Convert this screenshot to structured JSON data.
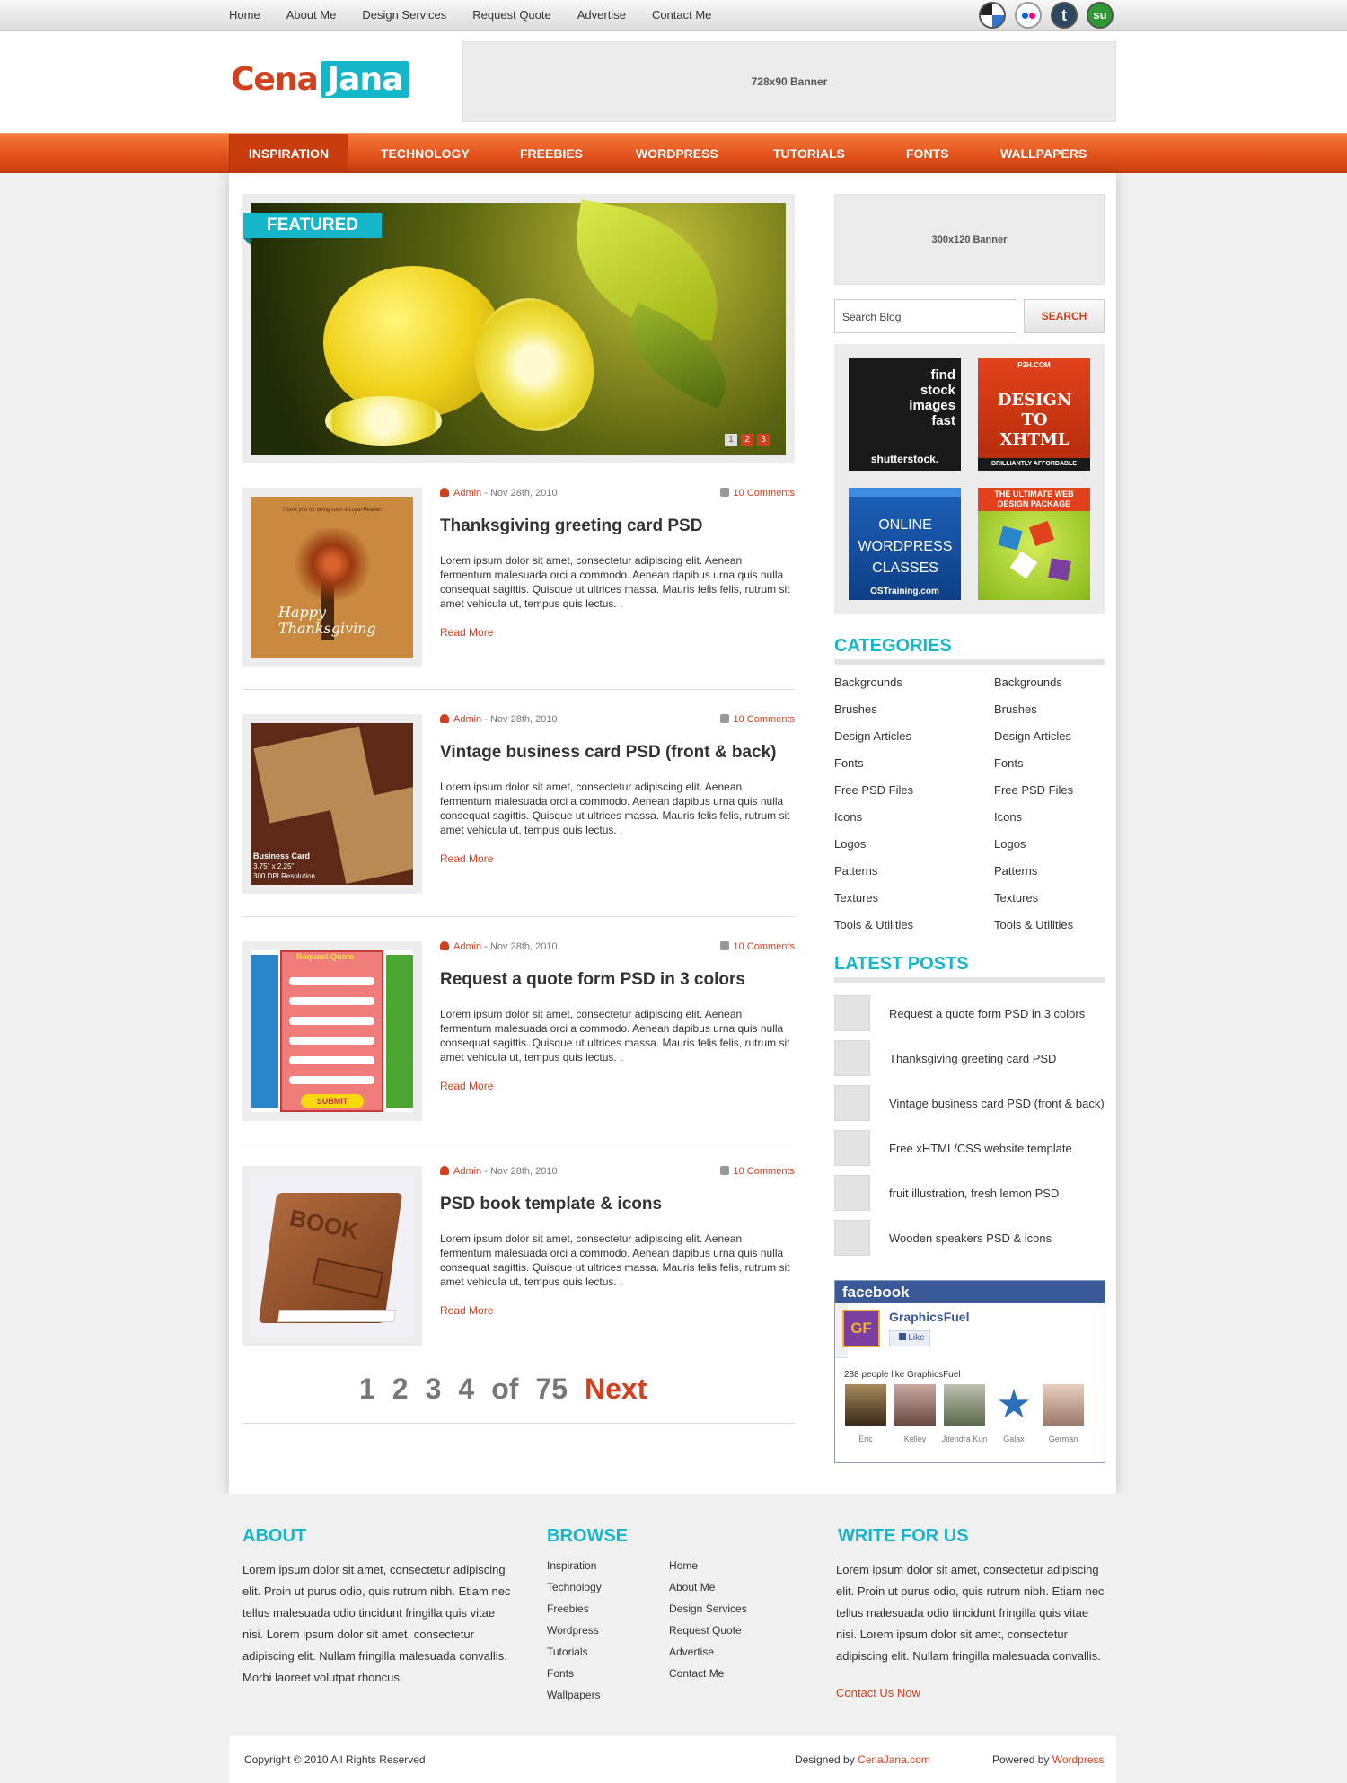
{
  "topnav": [
    "Home",
    "About Me",
    "Design Services",
    "Request Quote",
    "Advertise",
    "Contact Me"
  ],
  "social": [
    "delicious-icon",
    "flickr-icon",
    "tumblr-icon",
    "stumbleupon-icon"
  ],
  "logo": {
    "first": "Cena",
    "second": "Jana"
  },
  "banner_top": "728x90 Banner",
  "mainnav": [
    "INSPIRATION",
    "TECHNOLOGY",
    "FREEBIES",
    "WORDPRESS",
    "TUTORIALS",
    "FONTS",
    "WALLPAPERS"
  ],
  "featured": {
    "label": "FEATURED",
    "pages": [
      "1",
      "2",
      "3"
    ]
  },
  "posts": [
    {
      "author": "Admin",
      "date": "Nov 28th, 2010",
      "comments": "10 Comments",
      "title": "Thanksgiving greeting card PSD",
      "body": "Lorem ipsum dolor sit amet, consectetur adipiscing elit. Aenean fermentum malesuada orci a commodo. Aenean dapibus urna quis nulla consequat sagittis. Quisque ut ultrices massa. Mauris felis felis, rutrum sit amet vehicula ut, tempus quis lectus. .",
      "more": "Read More",
      "thumb": {
        "line1": "Thank you for being such a Loyal Reader!",
        "line2": "Happy Thanksgiving"
      }
    },
    {
      "author": "Admin",
      "date": "Nov 28th, 2010",
      "comments": "10 Comments",
      "title": "Vintage business card PSD (front & back)",
      "body": "Lorem ipsum dolor sit amet, consectetur adipiscing elit. Aenean fermentum malesuada orci a commodo. Aenean dapibus urna quis nulla consequat sagittis. Quisque ut ultrices massa. Mauris felis felis, rutrum sit amet vehicula ut, tempus quis lectus. .",
      "more": "Read More",
      "thumb": {
        "line1": "Business Card",
        "line2": "3.75\" x 2.25\"",
        "line3": "300 DPI Resolution"
      }
    },
    {
      "author": "Admin",
      "date": "Nov 28th, 2010",
      "comments": "10 Comments",
      "title": "Request a quote form PSD in 3 colors",
      "body": "Lorem ipsum dolor sit amet, consectetur adipiscing elit. Aenean fermentum malesuada orci a commodo. Aenean dapibus urna quis nulla consequat sagittis. Quisque ut ultrices massa. Mauris felis felis, rutrum sit amet vehicula ut, tempus quis lectus. .",
      "more": "Read More",
      "thumb": {
        "line1": "Request Quote",
        "line2": "SUBMIT"
      }
    },
    {
      "author": "Admin",
      "date": "Nov 28th, 2010",
      "comments": "10 Comments",
      "title": "PSD book template & icons",
      "body": "Lorem ipsum dolor sit amet, consectetur adipiscing elit. Aenean fermentum malesuada orci a commodo. Aenean dapibus urna quis nulla consequat sagittis. Quisque ut ultrices massa. Mauris felis felis, rutrum sit amet vehicula ut, tempus quis lectus. .",
      "more": "Read More",
      "thumb": {
        "line1": "BOOK"
      }
    }
  ],
  "pager": {
    "pages": [
      "1",
      "2",
      "3",
      "4"
    ],
    "of": "of",
    "total": "75",
    "next": "Next"
  },
  "sidebar": {
    "banner": "300x120 Banner",
    "search_placeholder": "Search Blog",
    "search_button": "SEARCH",
    "ads": [
      {
        "t1": "find stock images fast",
        "t2": "shutterstock."
      },
      {
        "t1": "P2H.COM",
        "t2": "DESIGN TO XHTML",
        "t3": "BRILLIANTLY AFFORDABLE"
      },
      {
        "t1": "ONLINE WORDPRESS CLASSES",
        "t2": "OSTraining.com"
      },
      {
        "t1": "THE ULTIMATE WEB DESIGN PACKAGE"
      }
    ],
    "categories_title": "CATEGORIES",
    "categories": [
      "Backgrounds",
      "Brushes",
      "Design Articles",
      "Fonts",
      "Free PSD Files",
      "Icons",
      "Logos",
      "Patterns",
      "Textures",
      "Tools & Utilities"
    ],
    "latest_title": "LATEST POSTS",
    "latest": [
      "Request a quote form PSD in 3 colors",
      "Thanksgiving greeting card PSD",
      "Vintage business card PSD (front & back)",
      "Free xHTML/CSS website template",
      "fruit illustration, fresh lemon PSD",
      "Wooden speakers PSD & icons"
    ],
    "facebook": {
      "title": "facebook",
      "page": "GraphicsFuel",
      "like": "Like",
      "count": "288 people like GraphicsFuel",
      "fans": [
        "Eric",
        "Kelley",
        "Jitendra Kun",
        "Galax",
        "German"
      ],
      "logo": "GF"
    }
  },
  "footer": {
    "about_title": "ABOUT",
    "about_text": "Lorem ipsum dolor sit amet, consectetur adipiscing elit. Proin ut purus odio, quis rutrum nibh. Etiam nec tellus malesuada odio tincidunt fringilla quis vitae nisi. Lorem ipsum dolor sit amet, consectetur adipiscing elit. Nullam fringilla malesuada convallis. Morbi laoreet volutpat rhoncus.",
    "browse_title": "BROWSE",
    "browse_col1": [
      "Inspiration",
      "Technology",
      "Freebies",
      "Wordpress",
      "Tutorials",
      "Fonts",
      "Wallpapers"
    ],
    "browse_col2": [
      "Home",
      "About Me",
      "Design Services",
      "Request Quote",
      "Advertise",
      "Contact Me"
    ],
    "write_title": "WRITE FOR US",
    "write_text": "Lorem ipsum dolor sit amet, consectetur adipiscing elit. Proin ut purus odio, quis rutrum nibh. Etiam nec tellus malesuada odio tincidunt fringilla quis vitae nisi. Lorem ipsum dolor sit amet, consectetur adipiscing elit. Nullam fringilla malesuada convallis.",
    "contact_link": "Contact Us Now"
  },
  "copyright": {
    "left": "Copyright © 2010 All Rights Reserved",
    "designed_prefix": "Designed by ",
    "designed_link": "CenaJana.com",
    "powered_prefix": "Powered by ",
    "powered_link": "Wordpress"
  },
  "colors": {
    "accent": "#d2401d",
    "teal": "#14b6c9",
    "nav": "#e0501a"
  }
}
